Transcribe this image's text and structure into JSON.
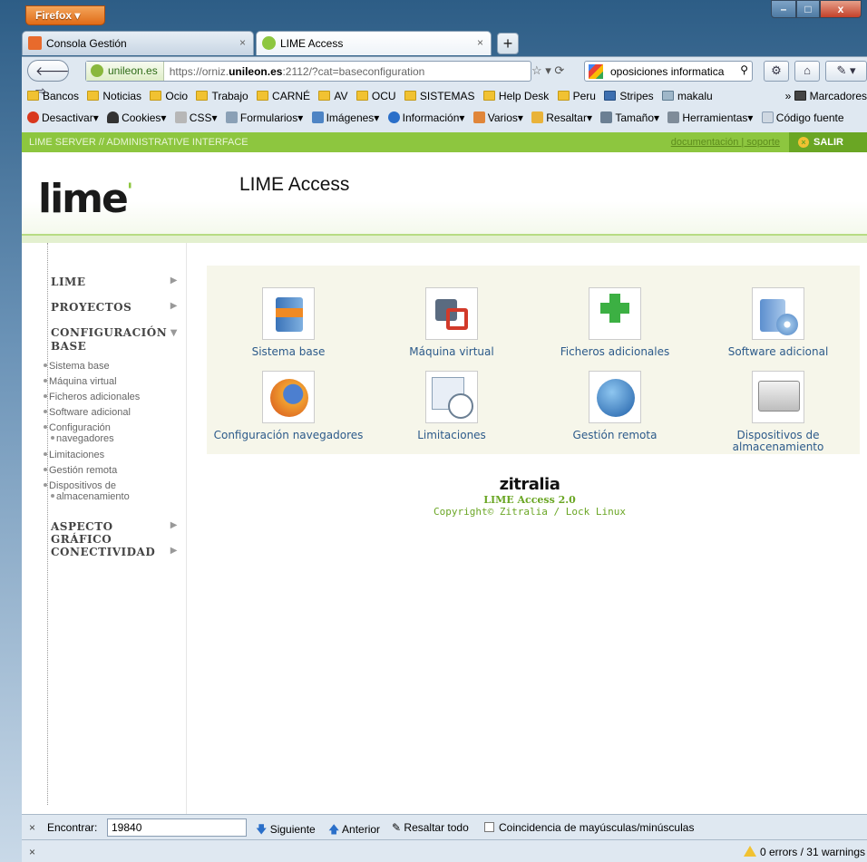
{
  "browser": {
    "menu_label": "Firefox ▾",
    "tabs": [
      {
        "label": "Consola Gestión",
        "icon": "console-icon"
      },
      {
        "label": "LIME Access",
        "icon": "lime-icon"
      }
    ],
    "url_identity": "unileon.es",
    "url_prefix": "https://orniz.",
    "url_domain": "unileon.es",
    "url_suffix": ":2112/?cat=baseconfiguration",
    "search_text": "oposiciones informatica",
    "bookmarks": [
      "Bancos",
      "Noticias",
      "Ocio",
      "Trabajo",
      "CARNÉ",
      "AV",
      "OCU",
      "SISTEMAS",
      "Help Desk",
      "Peru",
      "Stripes",
      "makalu"
    ],
    "bookmarks_more": "» ",
    "bookmarks_menu": "Marcadores",
    "toolbar": [
      "Desactivar",
      "Cookies",
      "CSS",
      "Formularios",
      "Imágenes",
      "Información",
      "Varios",
      "Resaltar",
      "Tamaño",
      "Herramientas",
      "Código fuente"
    ]
  },
  "page": {
    "strip_title": "LIME SERVER // ADMINISTRATIVE INTERFACE",
    "strip_links": "documentación | soporte",
    "salir": "SALIR",
    "logo_text_a": "li",
    "logo_text_b": "me",
    "app_title": "LIME Access",
    "sidebar": {
      "lime": "LIME",
      "proyectos": "PROYECTOS",
      "config_line1": "CONFIGURACIÓN",
      "config_line2": "BASE",
      "subitems": [
        "Sistema base",
        "Máquina virtual",
        "Ficheros adicionales",
        "Software adicional",
        "Configuración",
        "navegadores",
        "Limitaciones",
        "Gestión remota",
        "Dispositivos de",
        "almacenamiento"
      ],
      "aspecto": "ASPECTO GRÁFICO",
      "conectividad": "CONECTIVIDAD"
    },
    "grid": [
      {
        "label": "Sistema base",
        "icon": "server-icon"
      },
      {
        "label": "Máquina virtual",
        "icon": "virtual-machine-icon"
      },
      {
        "label": "Ficheros adicionales",
        "icon": "add-file-icon"
      },
      {
        "label": "Software adicional",
        "icon": "software-cd-icon"
      },
      {
        "label": "Configuración navegadores",
        "icon": "firefox-icon"
      },
      {
        "label": "Limitaciones",
        "icon": "clock-calendar-icon"
      },
      {
        "label": "Gestión remota",
        "icon": "globe-user-icon"
      },
      {
        "label": "Dispositivos de almacenamiento",
        "icon": "hard-drive-icon"
      }
    ],
    "footer": {
      "brand": "zitralia",
      "version": "LIME Access 2.0",
      "copyright": "Copyright© Zitralia / Lock Linux"
    }
  },
  "findbar": {
    "label": "Encontrar:",
    "value": "19840",
    "next": "Siguiente",
    "prev": "Anterior",
    "highlight": "Resaltar todo",
    "match_case": "Coincidencia de mayúsculas/minúsculas"
  },
  "status": {
    "warnings": "0 errors / 31 warnings"
  }
}
